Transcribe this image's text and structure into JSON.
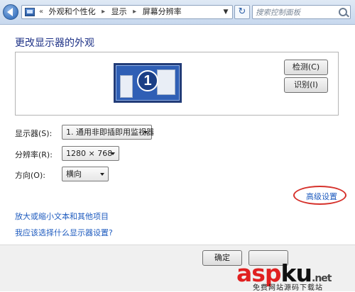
{
  "address_bar": {
    "crumbs": [
      "外观和个性化",
      "显示",
      "屏幕分辨率"
    ],
    "search_placeholder": "搜索控制面板"
  },
  "page": {
    "title": "更改显示器的外观",
    "monitor_number": "1",
    "detect_button": "检测(C)",
    "identify_button": "识别(I)"
  },
  "settings": {
    "display_label": "显示器(S):",
    "display_value": "1. 通用非即插即用监视器",
    "resolution_label": "分辨率(R):",
    "resolution_value": "1280 × 768",
    "orientation_label": "方向(O):",
    "orientation_value": "横向"
  },
  "links": {
    "advanced": "高级设置",
    "text_size": "放大或缩小文本和其他项目",
    "which_display": "我应该选择什么显示器设置?"
  },
  "footer": {
    "ok_button": "确定"
  },
  "watermark": {
    "part1": "asp",
    "part2": "ku",
    "part3": "",
    "domain": ".net",
    "subtitle": "免费网站源码下载站"
  },
  "colors": {
    "title": "#1e3287",
    "link": "#1e5bbf",
    "highlight": "#d6312b"
  }
}
